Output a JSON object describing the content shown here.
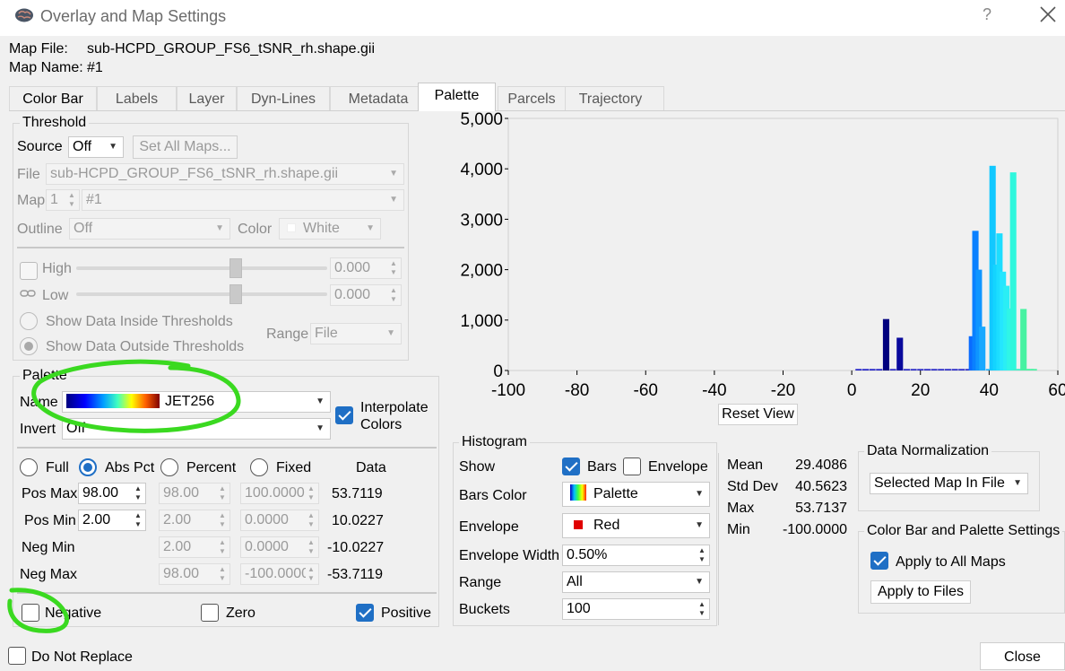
{
  "window": {
    "title": "Overlay and Map Settings",
    "help": "?"
  },
  "map_file": {
    "label": "Map File:",
    "value": "sub-HCPD_GROUP_FS6_tSNR_rh.shape.gii"
  },
  "map_name": {
    "label": "Map Name:",
    "value": "#1"
  },
  "tabs": [
    "Color Bar",
    "Labels",
    "Layer",
    "Dyn-Lines",
    "Metadata",
    "Palette",
    "Parcels",
    "Trajectory"
  ],
  "active_tab": "Palette",
  "threshold": {
    "title": "Threshold",
    "source_label": "Source",
    "source_value": "Off",
    "set_all_maps": "Set All Maps...",
    "file_label": "File",
    "file_value": "sub-HCPD_GROUP_FS6_tSNR_rh.shape.gii",
    "map_label": "Map",
    "map_index": "1",
    "map_value": "#1",
    "outline_label": "Outline",
    "outline_value": "Off",
    "color_label": "Color",
    "color_value": "White",
    "high_label": "High",
    "high_value": "0.000",
    "low_label": "Low",
    "low_value": "0.000",
    "inside_label": "Show Data Inside Thresholds",
    "outside_label": "Show Data Outside Thresholds",
    "range_label": "Range",
    "range_value": "File"
  },
  "palette": {
    "title": "Palette",
    "name_label": "Name",
    "name_value": "JET256",
    "invert_label": "Invert",
    "invert_value": "Off",
    "interpolate_label": "Interpolate Colors",
    "modes": [
      "Full",
      "Abs Pct",
      "Percent",
      "Fixed"
    ],
    "selected_mode": "Abs Pct",
    "data_header": "Data",
    "rows": [
      {
        "label": "Pos Max",
        "abs": "98.00",
        "pct": "98.00",
        "fixed": "100.0000",
        "data": "53.7119"
      },
      {
        "label": "Pos Min",
        "abs": "2.00",
        "pct": "2.00",
        "fixed": "0.0000",
        "data": "10.0227"
      },
      {
        "label": "Neg Min",
        "abs": "",
        "pct": "2.00",
        "fixed": "0.0000",
        "data": "-10.0227"
      },
      {
        "label": "Neg Max",
        "abs": "",
        "pct": "98.00",
        "fixed": "-100.0000",
        "data": "-53.7119"
      }
    ],
    "negative_label": "Negative",
    "zero_label": "Zero",
    "positive_label": "Positive"
  },
  "histogram_controls": {
    "title": "Histogram",
    "show_label": "Show",
    "bars_label": "Bars",
    "envelope_label": "Envelope",
    "bars_color_label": "Bars Color",
    "bars_color_value": "Palette",
    "envelope_label2": "Envelope",
    "envelope_color_value": "Red",
    "envelope_width_label": "Envelope Width",
    "envelope_width_value": "0.50%",
    "range_label": "Range",
    "range_value": "All",
    "buckets_label": "Buckets",
    "buckets_value": "100",
    "reset_view": "Reset View"
  },
  "stats": [
    {
      "label": "Mean",
      "value": "29.4086"
    },
    {
      "label": "Std Dev",
      "value": "40.5623"
    },
    {
      "label": "Max",
      "value": "53.7137"
    },
    {
      "label": "Min",
      "value": "-100.0000"
    }
  ],
  "data_normalization": {
    "title": "Data Normalization",
    "value": "Selected Map In File"
  },
  "colorbar_settings": {
    "title": "Color Bar and Palette Settings",
    "apply_all": "Apply to All Maps",
    "apply_files": "Apply to Files"
  },
  "footer": {
    "do_not_replace": "Do Not Replace",
    "close": "Close"
  },
  "chart_data": {
    "type": "bar",
    "xlim": [
      -100,
      60
    ],
    "ylim": [
      0,
      5000
    ],
    "x_ticks": [
      "-100",
      "-80",
      "-60",
      "-40",
      "-20",
      "0",
      "20",
      "40",
      "60"
    ],
    "y_ticks": [
      "5,000",
      "4,000",
      "3,000",
      "2,000",
      "1,000",
      "0"
    ],
    "x": [
      2,
      4,
      6,
      8,
      10,
      12,
      14,
      16,
      18,
      20,
      22,
      24,
      26,
      28,
      30,
      32,
      34,
      35,
      36,
      37,
      38,
      40,
      41,
      42,
      43,
      44,
      45,
      46,
      47,
      48,
      49,
      50,
      51,
      52,
      53
    ],
    "values": [
      30,
      30,
      30,
      30,
      1020,
      30,
      650,
      30,
      30,
      30,
      30,
      30,
      30,
      30,
      30,
      30,
      30,
      680,
      2770,
      2000,
      870,
      30,
      4060,
      2100,
      2720,
      1960,
      1680,
      1230,
      3930,
      30,
      30,
      1220,
      30,
      30,
      30
    ],
    "colors": [
      "#2222c8",
      "#2222c8",
      "#2222c8",
      "#2222c8",
      "#00007e",
      "#2a2ac8",
      "#0a0a9c",
      "#2a2ac8",
      "#2a2ac8",
      "#2a2ac8",
      "#2a2ac8",
      "#2a2ac8",
      "#2a2ac8",
      "#2a2ac8",
      "#2a2ac8",
      "#2a2ac8",
      "#2a2ac8",
      "#0a6cff",
      "#0a80ff",
      "#0f95ff",
      "#17a8ff",
      "#20b0ff",
      "#12c8ff",
      "#14d4ff",
      "#1cddff",
      "#25e6ff",
      "#2aeef5",
      "#2ff5e8",
      "#30f7dd",
      "#40f0c8",
      "#40f0c8",
      "#47f2a2",
      "#47f2a2",
      "#47f2a2",
      "#47f2a2"
    ]
  }
}
